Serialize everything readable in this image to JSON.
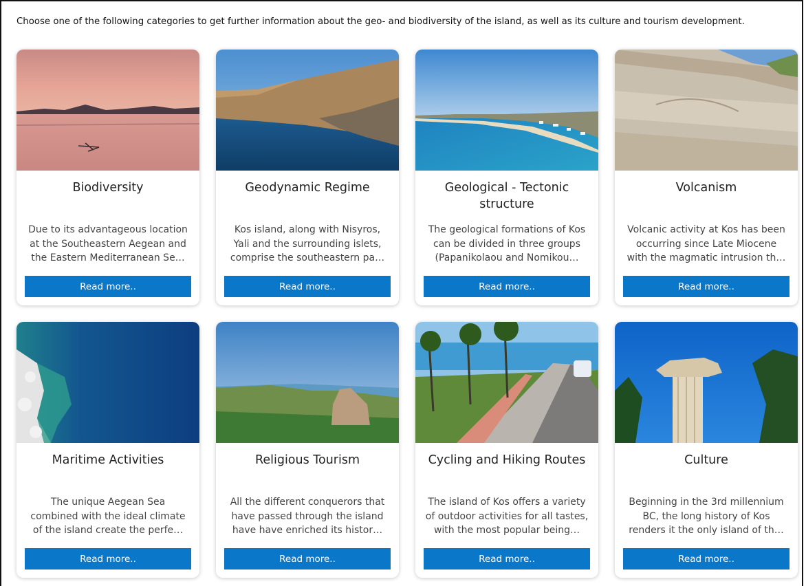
{
  "intro": "Choose one of the following categories to get further information about the geo- and biodiversity of the island, as well as its culture and tourism development.",
  "cards": [
    {
      "title": "Biodiversity",
      "desc_lines": [
        "Due to its advantageous location",
        "at the Southeastern Aegean and",
        "the Eastern Mediterranean Se…"
      ],
      "button": "Read more..",
      "image": "pink-sunset-lagoon"
    },
    {
      "title": "Geodynamic Regime",
      "desc_lines": [
        "Kos island, along with Nisyros,",
        "Yali and the surrounding islets,",
        "comprise the southeastern pa…"
      ],
      "button": "Read more..",
      "image": "coastal-cliff-sea"
    },
    {
      "title": "Geological - Tectonic structure",
      "desc_lines": [
        "The geological formations of Kos",
        "can be divided in three groups",
        "(Papanikolaou and Nomikou…"
      ],
      "button": "Read more..",
      "image": "beach-coastline"
    },
    {
      "title": "Volcanism",
      "desc_lines": [
        "Volcanic activity at Kos has been",
        "occurring since Late Miocene",
        "with the magmatic intrusion th…"
      ],
      "button": "Read more..",
      "image": "rock-outcrop"
    },
    {
      "title": "Maritime Activities",
      "desc_lines": [
        "The unique Aegean Sea",
        "combined with the ideal climate",
        "of the island create the perfe…"
      ],
      "button": "Read more..",
      "image": "aerial-sea-coast"
    },
    {
      "title": "Religious Tourism",
      "desc_lines": [
        "All the different conquerors that",
        "have passed through the island",
        "have have enriched its histor…"
      ],
      "button": "Read more..",
      "image": "hillside-ruins"
    },
    {
      "title": "Cycling and Hiking Routes",
      "desc_lines": [
        "The island of Kos offers a variety",
        "of outdoor activities for all tastes,",
        "with the most popular being…"
      ],
      "button": "Read more..",
      "image": "palm-promenade"
    },
    {
      "title": "Culture",
      "desc_lines": [
        "Beginning in the 3rd millennium",
        "BC, the long history of Kos",
        "renders it the only island of th…"
      ],
      "button": "Read more..",
      "image": "ancient-column"
    }
  ],
  "colors": {
    "button": "#0b77c9",
    "title": "#222222",
    "desc": "#444444"
  }
}
